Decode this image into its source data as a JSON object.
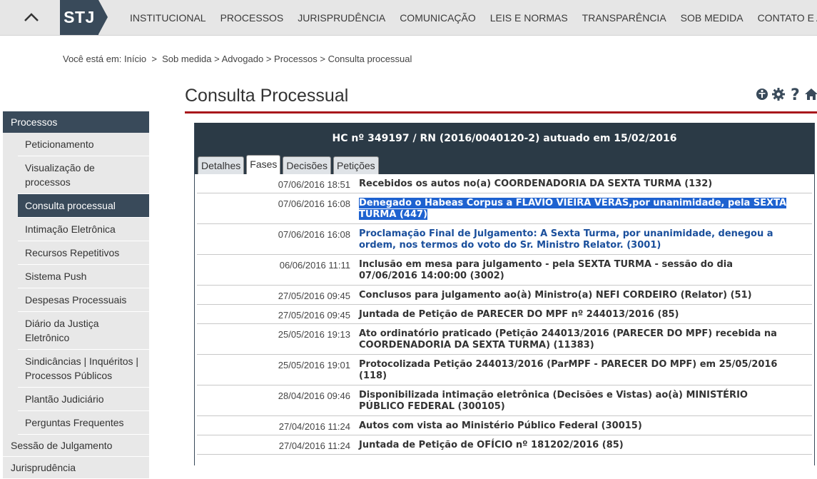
{
  "nav": {
    "logo": "STJ",
    "items": [
      "INSTITUCIONAL",
      "PROCESSOS",
      "JURISPRUDÊNCIA",
      "COMUNICAÇÃO",
      "LEIS E NORMAS",
      "TRANSPARÊNCIA",
      "SOB MEDIDA",
      "CONTATO E AJUDA"
    ]
  },
  "breadcrumb": {
    "prefix": "Você está em:",
    "items": [
      "Início",
      "Sob medida",
      "Advogado",
      "Processos",
      "Consulta processual"
    ],
    "sep_space": " > ",
    "sep_first": "  >  "
  },
  "sidebar": {
    "header": "Processos",
    "items": [
      "Peticionamento",
      "Visualização de processos",
      "Consulta processual",
      "Intimação Eletrônica",
      "Recursos Repetitivos",
      "Sistema Push",
      "Despesas Processuais",
      "Diário da Justiça Eletrônico",
      "Sindicâncias | Inquéritos | Processos Públicos",
      "Plantão Judiciário",
      "Perguntas Frequentes"
    ],
    "active_index": 2,
    "after": [
      "Sessão de Julgamento",
      "Jurisprudência"
    ]
  },
  "page": {
    "title": "Consulta Processual"
  },
  "panel": {
    "title": "HC nº 349197 / RN (2016/0040120-2) autuado em 15/02/2016",
    "tabs": [
      "Detalhes",
      "Fases",
      "Decisões",
      "Petições"
    ],
    "active_tab": 1
  },
  "fases": [
    {
      "dt": "07/06/2016 18:51",
      "tx": "Recebidos os autos no(a) COORDENADORIA DA SEXTA TURMA (132)",
      "style": "plain"
    },
    {
      "dt": "07/06/2016 16:08",
      "tx": "Denegado o Habeas Corpus a FLÁVIO VIEIRA VERAS,por unanimidade, pela SEXTA TURMA (447)",
      "style": "selected"
    },
    {
      "dt": "07/06/2016 16:08",
      "tx": "Proclamação Final de Julgamento: A Sexta Turma, por unanimidade, denegou a ordem, nos termos do voto do Sr. Ministro Relator. (3001)",
      "style": "link"
    },
    {
      "dt": "06/06/2016 11:11",
      "tx": "Inclusão em mesa para julgamento - pela SEXTA TURMA - sessão do dia 07/06/2016 14:00:00 (3002)",
      "style": "plain"
    },
    {
      "dt": "27/05/2016 09:45",
      "tx": "Conclusos para julgamento ao(à) Ministro(a) NEFI CORDEIRO (Relator) (51)",
      "style": "plain"
    },
    {
      "dt": "27/05/2016 09:45",
      "tx": "Juntada de Petição de PARECER DO MPF nº 244013/2016 (85)",
      "style": "plain"
    },
    {
      "dt": "25/05/2016 19:13",
      "tx": "Ato ordinatório praticado (Petição 244013/2016 (PARECER DO MPF) recebida na COORDENADORIA DA SEXTA TURMA) (11383)",
      "style": "plain"
    },
    {
      "dt": "25/05/2016 19:01",
      "tx": "Protocolizada Petição 244013/2016 (ParMPF - PARECER DO MPF) em 25/05/2016 (118)",
      "style": "plain"
    },
    {
      "dt": "28/04/2016 09:46",
      "tx": "Disponibilizada intimação eletrônica (Decisões e Vistas) ao(à) MINISTÉRIO PÚBLICO FEDERAL (300105)",
      "style": "plain"
    },
    {
      "dt": "27/04/2016 11:24",
      "tx": "Autos com vista ao Ministério Público Federal (30015)",
      "style": "plain"
    },
    {
      "dt": "27/04/2016 11:24",
      "tx": "Juntada de Petição de OFÍCIO nº 181202/2016 (85)",
      "style": "plain"
    }
  ],
  "colors": {
    "nav_bg": "#e6e6e6",
    "dark": "#394a5a",
    "accent_red": "#a8161b",
    "link_blue": "#1a4f9c",
    "selection": "#1e62d0"
  },
  "icons": [
    "chevron-up-icon",
    "accessibility-icon",
    "gear-icon",
    "help-icon",
    "home-icon"
  ]
}
